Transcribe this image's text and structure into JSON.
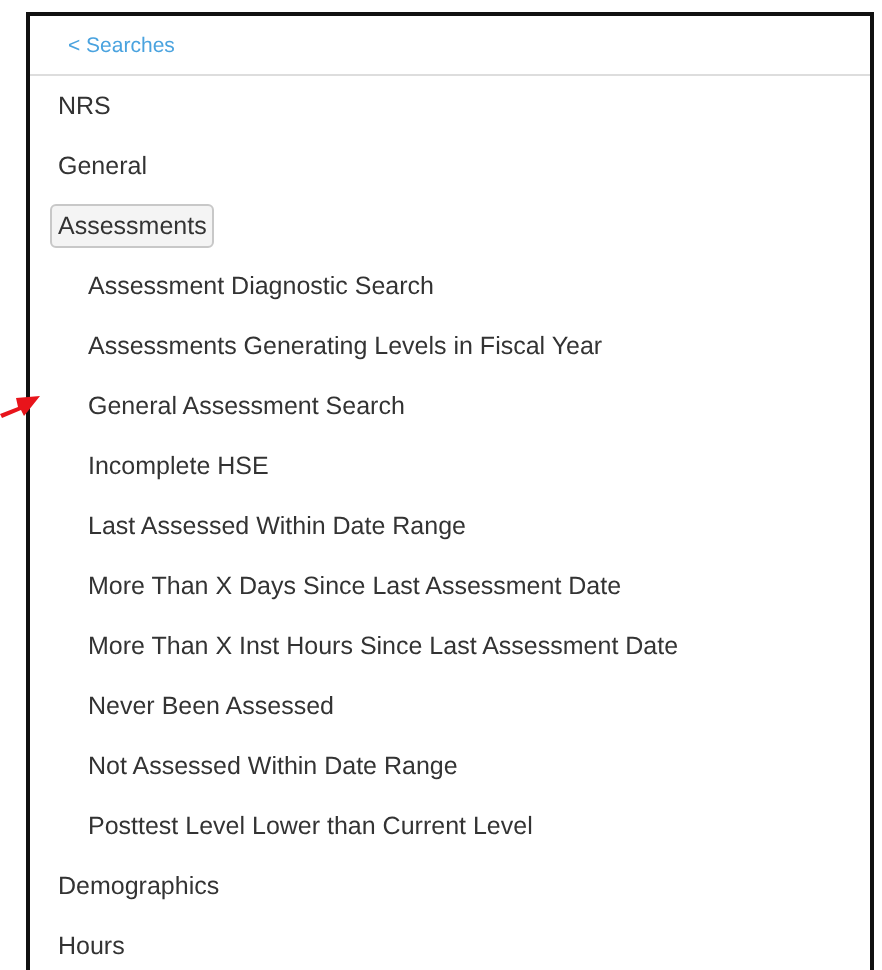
{
  "back_link": "< Searches",
  "categories": [
    {
      "label": "NRS",
      "selected": false
    },
    {
      "label": "General",
      "selected": false
    },
    {
      "label": "Assessments",
      "selected": true,
      "expanded": true,
      "children": [
        {
          "label": "Assessment Diagnostic Search"
        },
        {
          "label": "Assessments Generating Levels in Fiscal Year"
        },
        {
          "label": "General Assessment Search",
          "pointed": true
        },
        {
          "label": "Incomplete HSE"
        },
        {
          "label": "Last Assessed Within Date Range"
        },
        {
          "label": "More Than X Days Since Last Assessment Date"
        },
        {
          "label": "More Than X Inst Hours Since Last Assessment Date"
        },
        {
          "label": "Never Been Assessed"
        },
        {
          "label": "Not Assessed Within Date Range"
        },
        {
          "label": "Posttest Level Lower than Current Level"
        }
      ]
    },
    {
      "label": "Demographics",
      "selected": false
    },
    {
      "label": "Hours",
      "selected": false
    }
  ]
}
